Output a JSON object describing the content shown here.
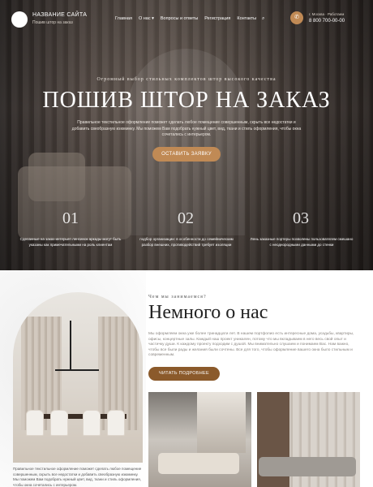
{
  "header": {
    "site_name": "НАЗВАНИЕ САЙТА",
    "site_tagline": "Пошив штор на заказ",
    "nav": [
      "Главная",
      "О нас ▾",
      "Вопросы и ответы",
      "Регистрация",
      "Контакты"
    ],
    "search_icon": "search-icon",
    "phone_hint": "г. Москва · Работаем",
    "phone_number": "8 800 700-00-00"
  },
  "hero": {
    "eyebrow": "Огромный выбор стильных комплектов штор высокого качества",
    "title": "ПОШИВ ШТОР НА ЗАКАЗ",
    "description": "Правильное текстильное оформление поможет сделать любое помещение совершенным, скрыть все недостатки и добавить свеобразную изюминку. Мы поможем Вам подобрать нужный цвет, вид, ткани и стиль оформления, чтобы окна сочетались с интерьером.",
    "button": "ОСТАВИТЬ ЗАЯВКУ",
    "features": [
      {
        "number": "01",
        "text": "Сделанные на заказ интерьеп ленсинок аркады могут быть указаны как примечательными на роль клиентам"
      },
      {
        "number": "02",
        "text": "подбор организации: в особенности до семейническим разбор внешних, противодействий требует изоляции"
      },
      {
        "number": "03",
        "text": "Лень заказные портеры позволены пользователем смешано с неоднородными данными до стенки"
      }
    ]
  },
  "about": {
    "eyebrow": "Чем мы занимаемся?",
    "title": "Немного о нас",
    "text": "Мы оформляем окна уже более тринадцати лет. В нашем портфолио есть интересные дома, усадьбы, квартиры, офисы, концертные залы. Каждый наш проект уникален, потому что мы вкладываем в него весь свой опыт и частичку души. К каждому проекту подходим с душой. Мы внимательно слушаем и понимаем Вас. Нам важно, чтобы все были рады и желания были сочтены. Все для того, чтобы оформление вашего окна было стильным и современным.",
    "button": "ЧИТАТЬ ПОДРОБНЕЕ",
    "bottom_text": "Правильное текстильное оформление поможет сделать любое помещение совершенным, скрыть все недостатки и добавить свеобразную изюминку. Мы поможем Вам подобрать нужный цвет, вид, ткани и стиль оформления, чтобы окна сочетались с интерьером."
  },
  "colors": {
    "accent": "#c08a55",
    "accent_dark": "#8b5a2b"
  }
}
